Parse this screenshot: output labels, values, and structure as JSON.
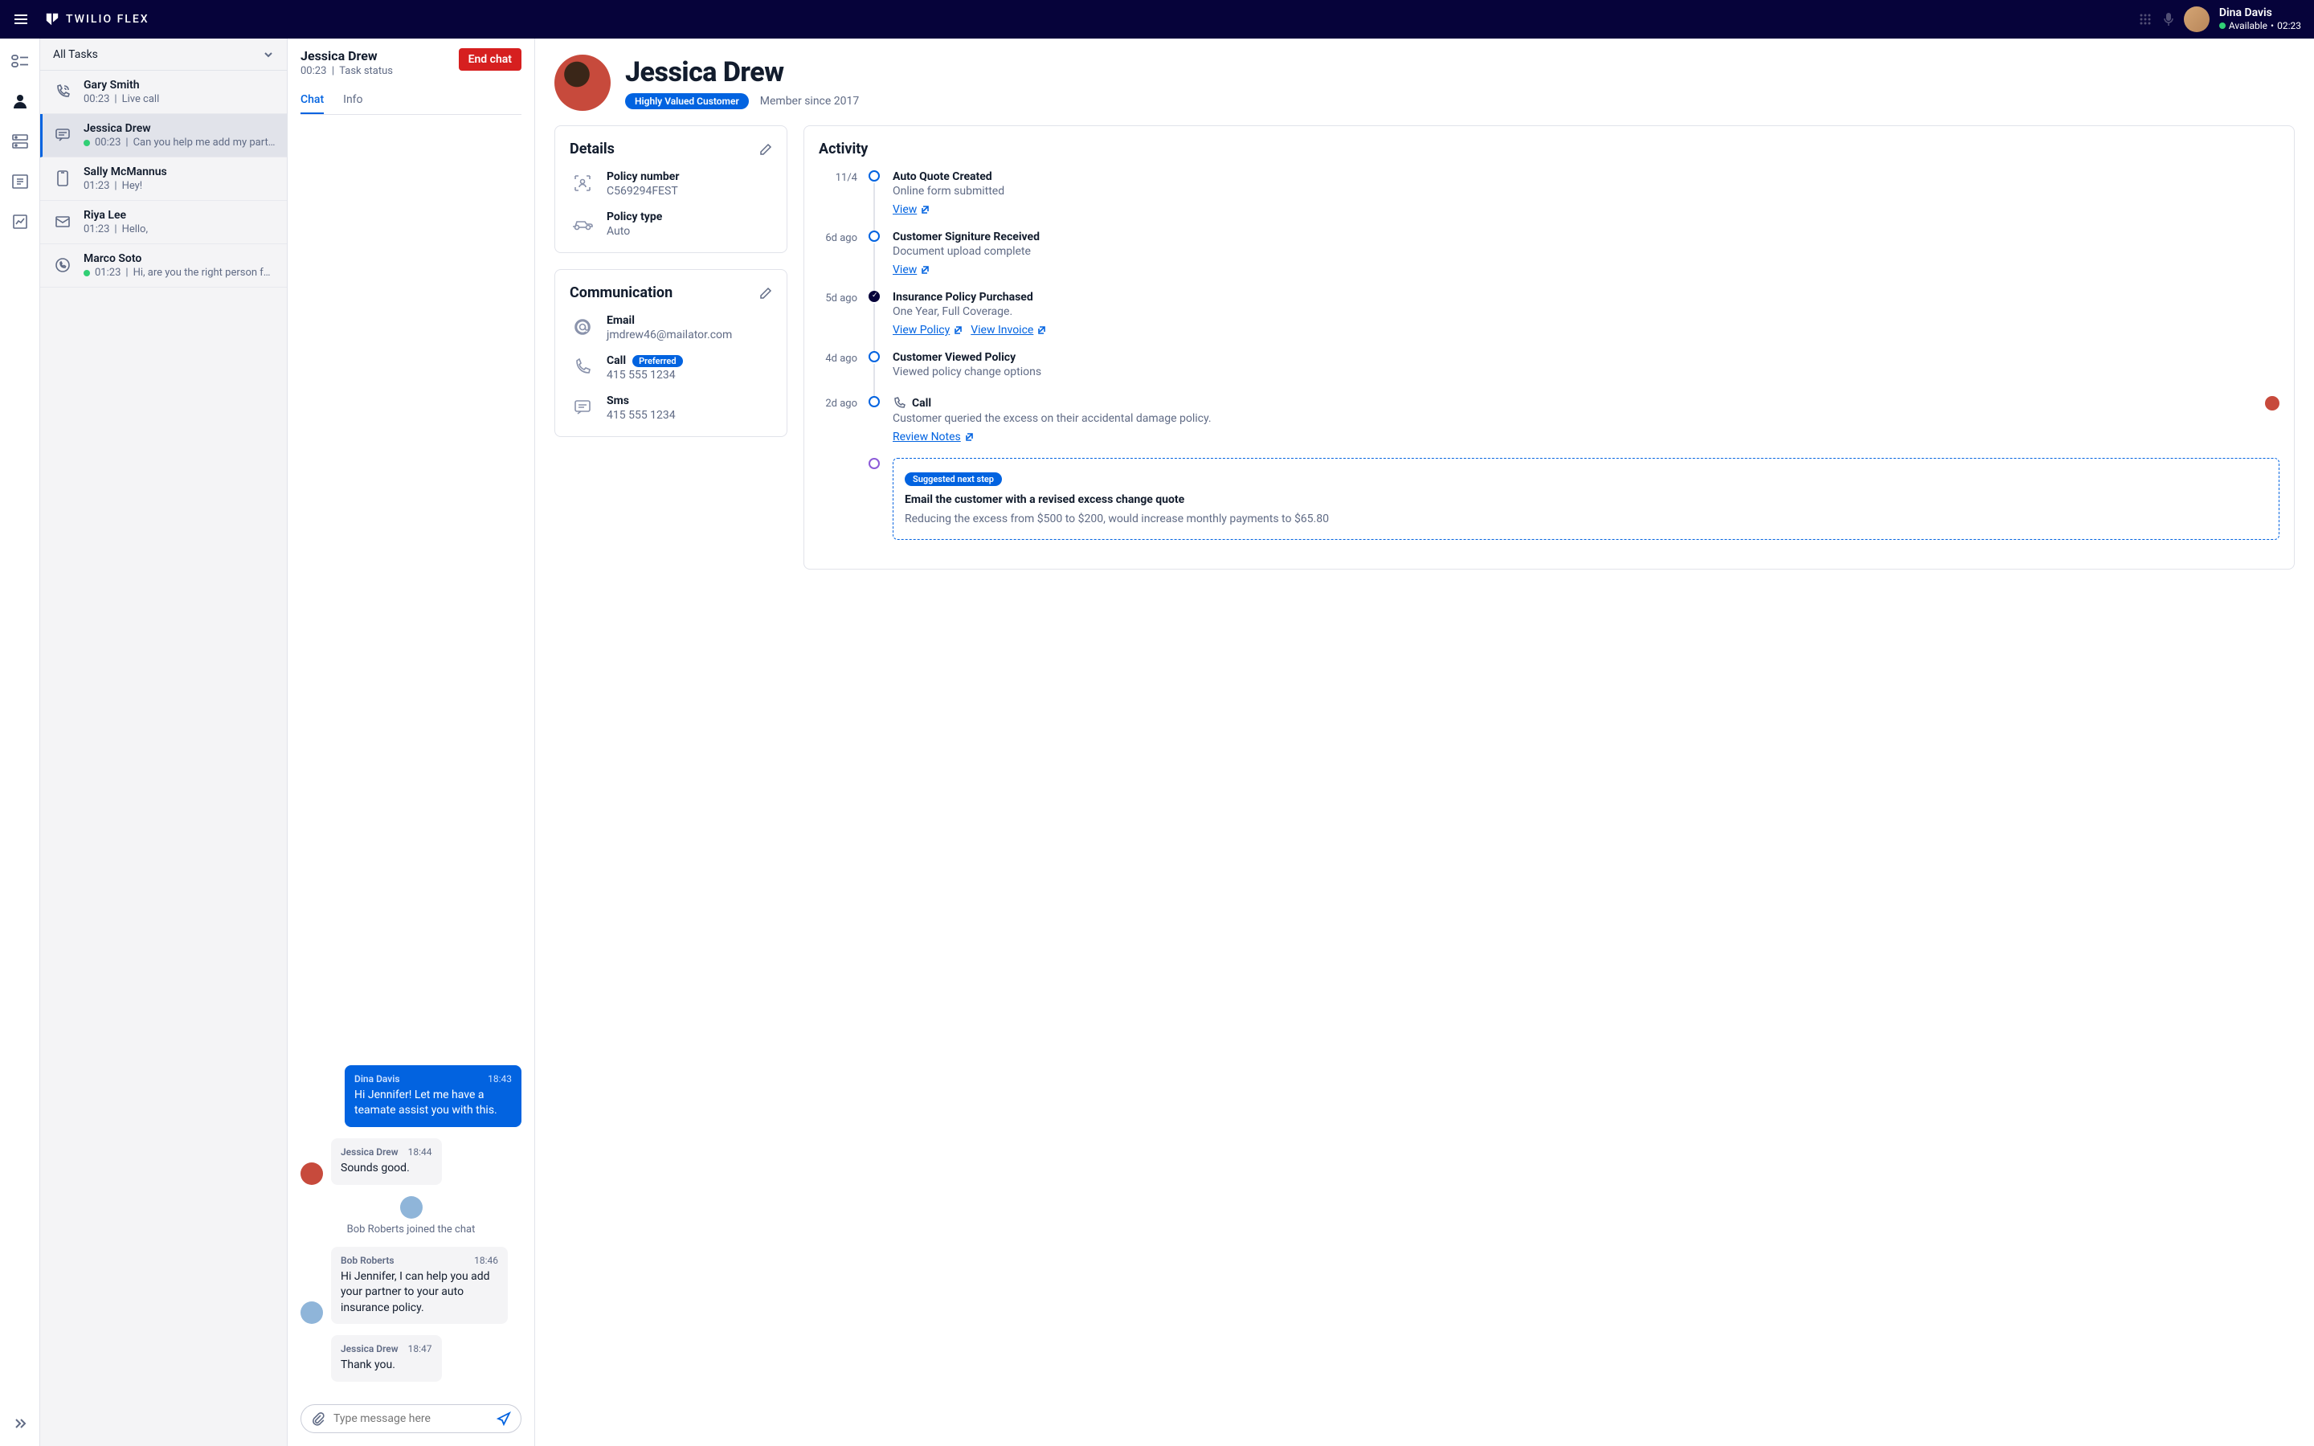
{
  "header": {
    "brand": "TWILIO FLEX",
    "user_name": "Dina Davis",
    "user_status": "Available",
    "user_time": "02:23"
  },
  "tasks": {
    "header": "All Tasks",
    "items": [
      {
        "name": "Gary Smith",
        "time": "00:23",
        "preview": "Live call",
        "online": false,
        "type": "call"
      },
      {
        "name": "Jessica Drew",
        "time": "00:23",
        "preview": "Can you help me add my part...",
        "online": true,
        "type": "chat"
      },
      {
        "name": "Sally McMannus",
        "time": "01:23",
        "preview": "Hey!",
        "online": false,
        "type": "sms"
      },
      {
        "name": "Riya Lee",
        "time": "01:23",
        "preview": "Hello,",
        "online": false,
        "type": "email"
      },
      {
        "name": "Marco Soto",
        "time": "01:23",
        "preview": "Hi, are you the right person fo...",
        "online": true,
        "type": "whatsapp"
      }
    ]
  },
  "chat": {
    "title": "Jessica Drew",
    "time": "00:23",
    "status": "Task status",
    "end_label": "End chat",
    "tab_chat": "Chat",
    "tab_info": "Info",
    "messages": [
      {
        "dir": "out",
        "name": "Dina Davis",
        "time": "18:43",
        "text": "Hi Jennifer! Let me have a teamate assist you with this."
      },
      {
        "dir": "in",
        "name": "Jessica Drew",
        "time": "18:44",
        "text": "Sounds good."
      }
    ],
    "system_msg": "Bob Roberts joined the chat",
    "messages2": [
      {
        "dir": "in",
        "name": "Bob Roberts",
        "time": "18:46",
        "text": "Hi Jennifer, I can help you add your partner to your auto insurance policy."
      },
      {
        "dir": "in",
        "name": "Jessica Drew",
        "time": "18:47",
        "text": "Thank you."
      }
    ],
    "placeholder": "Type message here"
  },
  "crm": {
    "name": "Jessica Drew",
    "badge": "Highly Valued Customer",
    "member": "Member since 2017",
    "details": {
      "title": "Details",
      "items": [
        {
          "label": "Policy number",
          "value": "C569294FEST"
        },
        {
          "label": "Policy type",
          "value": "Auto"
        }
      ]
    },
    "communication": {
      "title": "Communication",
      "items": [
        {
          "label": "Email",
          "value": "jmdrew46@mailator.com",
          "preferred": false
        },
        {
          "label": "Call",
          "value": "415 555 1234",
          "preferred": true
        },
        {
          "label": "Sms",
          "value": "415 555 1234",
          "preferred": false
        }
      ],
      "preferred_label": "Preferred"
    },
    "activity": {
      "title": "Activity",
      "items": [
        {
          "date": "11/4",
          "title": "Auto Quote Created",
          "desc": "Online form submitted",
          "links": [
            "View"
          ],
          "filled": false
        },
        {
          "date": "6d ago",
          "title": "Customer Signiture Received",
          "desc": "Document upload complete",
          "links": [
            "View"
          ],
          "filled": false
        },
        {
          "date": "5d ago",
          "title": "Insurance Policy Purchased",
          "desc": "One Year, Full Coverage.",
          "links": [
            "View Policy",
            "View Invoice"
          ],
          "filled": true
        },
        {
          "date": "4d ago",
          "title": "Customer Viewed Policy",
          "desc": "Viewed policy change options",
          "links": [],
          "filled": false
        },
        {
          "date": "2d ago",
          "title": "Call",
          "desc": "Customer queried the excess on their accidental damage policy.",
          "links": [
            "Review Notes"
          ],
          "filled": false,
          "call": true
        }
      ],
      "suggest": {
        "badge": "Suggested next step",
        "title": "Email the customer with a revised excess change quote",
        "desc": "Reducing the excess from $500 to $200, would increase monthly payments to $65.80"
      }
    }
  }
}
